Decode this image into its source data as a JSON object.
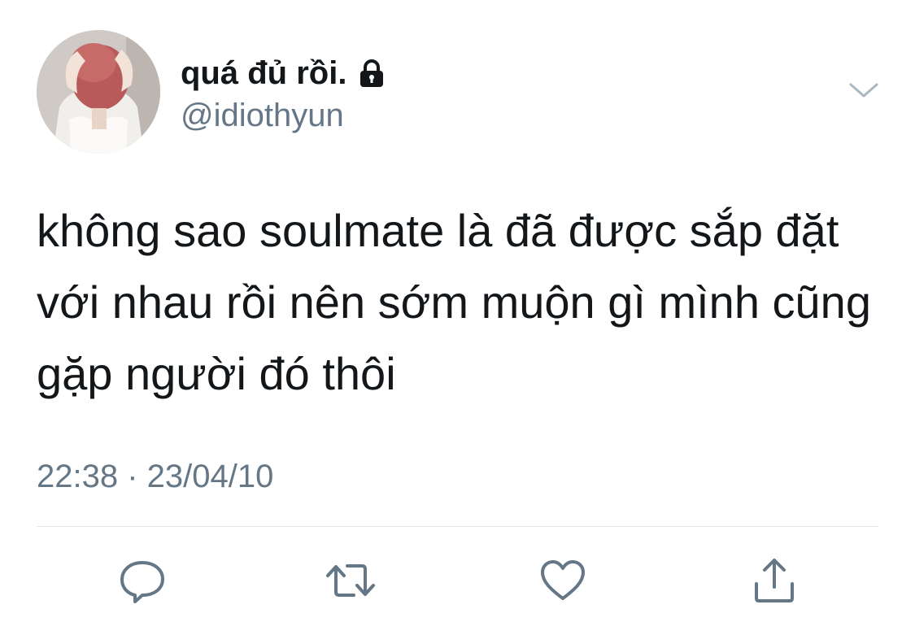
{
  "tweet": {
    "display_name": "quá đủ rồi.",
    "handle": "@idiothyun",
    "protected_icon": "lock-icon",
    "text": "không sao soulmate là đã được sắp đặt với nhau rồi nên sớm muộn gì mình cũng gặp người đó thôi",
    "timestamp": "22:38 · 23/04/10"
  },
  "actions": [
    {
      "name": "reply",
      "icon": "speech-bubble-icon"
    },
    {
      "name": "retweet",
      "icon": "retweet-icon"
    },
    {
      "name": "like",
      "icon": "heart-icon"
    },
    {
      "name": "share",
      "icon": "share-icon"
    }
  ],
  "colors": {
    "text_primary": "#14171a",
    "text_secondary": "#657786",
    "divider": "#e1e8ed",
    "icon": "#657786"
  }
}
